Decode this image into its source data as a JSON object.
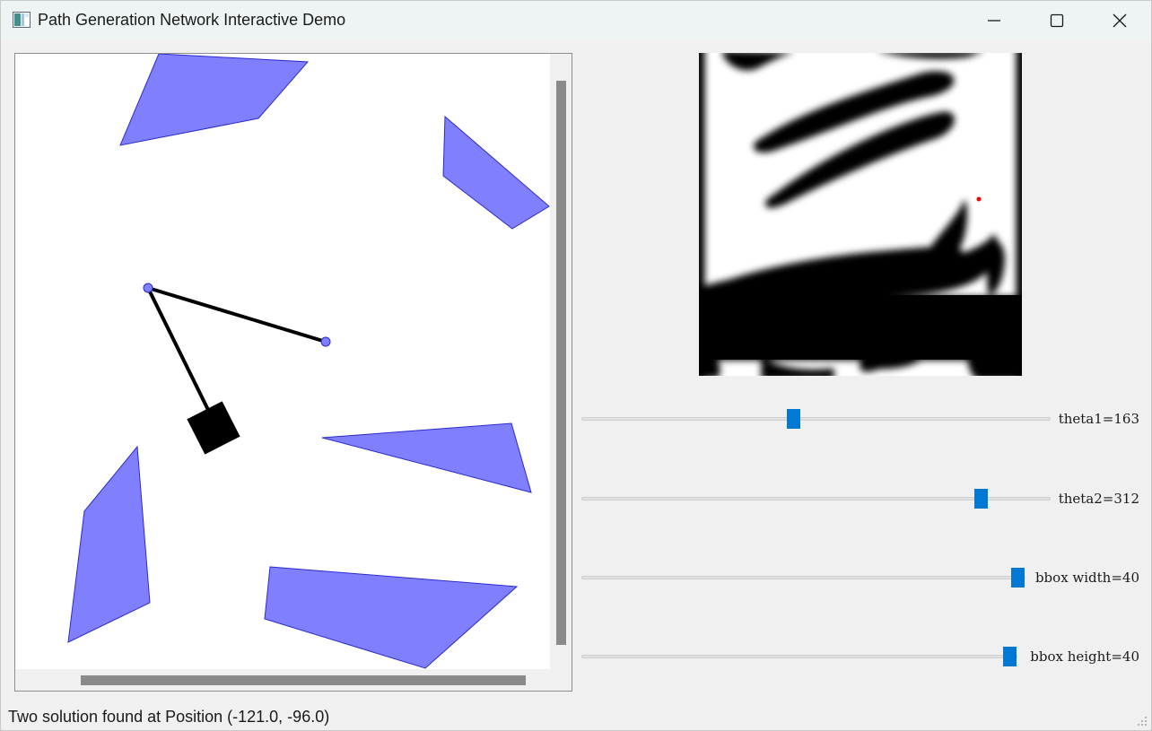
{
  "window": {
    "title": "Path Generation Network Interactive Demo",
    "minimize_icon": "minimize-icon",
    "maximize_icon": "maximize-icon",
    "close_icon": "close-icon"
  },
  "scene": {
    "obstacle_fill": "#8080ff",
    "obstacle_stroke": "#2a2ad0",
    "arm_color": "#000000",
    "joint_fill": "#8080ff"
  },
  "cspace": {
    "marker_color": "#ff0000"
  },
  "sliders": [
    {
      "label": "theta1=163",
      "value": 163
    },
    {
      "label": "theta2=312",
      "value": 312
    },
    {
      "label": "bbox width=40",
      "value": 40
    },
    {
      "label": "bbox height=40",
      "value": 40
    }
  ],
  "status": {
    "text": "Two solution found at Position (-121.0, -96.0)"
  },
  "accent": "#0078d4"
}
